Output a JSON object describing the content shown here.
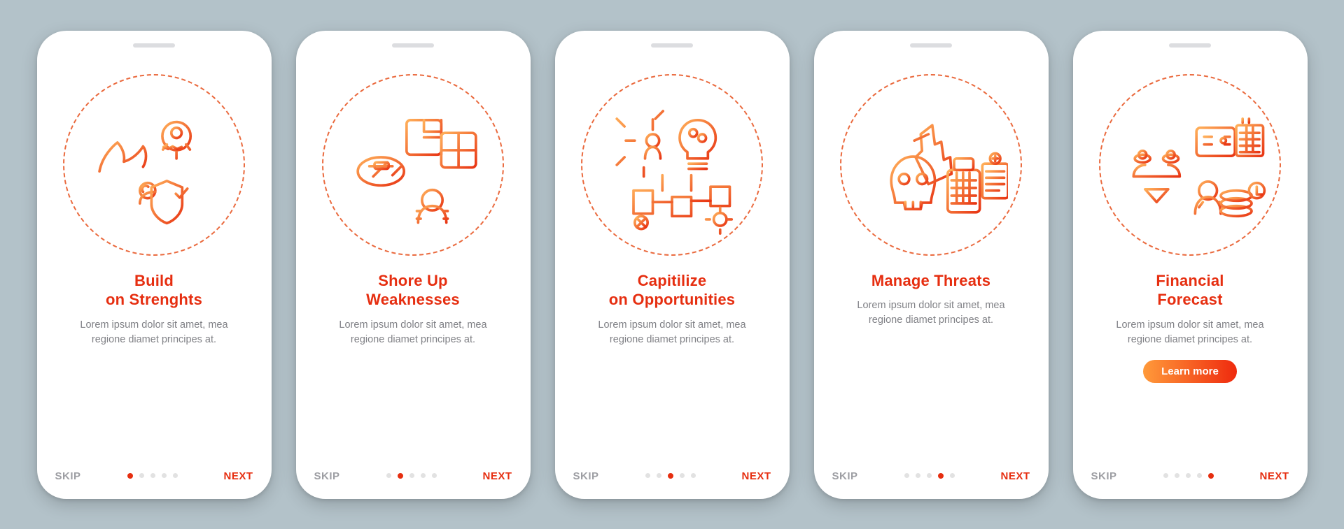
{
  "colors": {
    "accent": "#e62e10",
    "grad1": "#ff9a3a",
    "grad2": "#ef2a0e",
    "muted": "#808186",
    "dotOff": "#e2e2e2",
    "bg": "#b3c2c9"
  },
  "common": {
    "skip": "SKIP",
    "next": "NEXT",
    "learnMore": "Learn more",
    "body": "Lorem ipsum dolor sit amet, mea regione diamet principes at."
  },
  "screens": [
    {
      "title": "Build\non Strenghts",
      "activeDot": 0,
      "icon": "strengths",
      "hasCta": false
    },
    {
      "title": "Shore Up\nWeaknesses",
      "activeDot": 1,
      "icon": "weaknesses",
      "hasCta": false
    },
    {
      "title": "Capitilize\non Opportunities",
      "activeDot": 2,
      "icon": "opportunities",
      "hasCta": false
    },
    {
      "title": "Manage Threats",
      "activeDot": 3,
      "icon": "threats",
      "hasCta": false
    },
    {
      "title": "Financial\nForecast",
      "activeDot": 4,
      "icon": "forecast",
      "hasCta": true
    }
  ],
  "dotCount": 5
}
